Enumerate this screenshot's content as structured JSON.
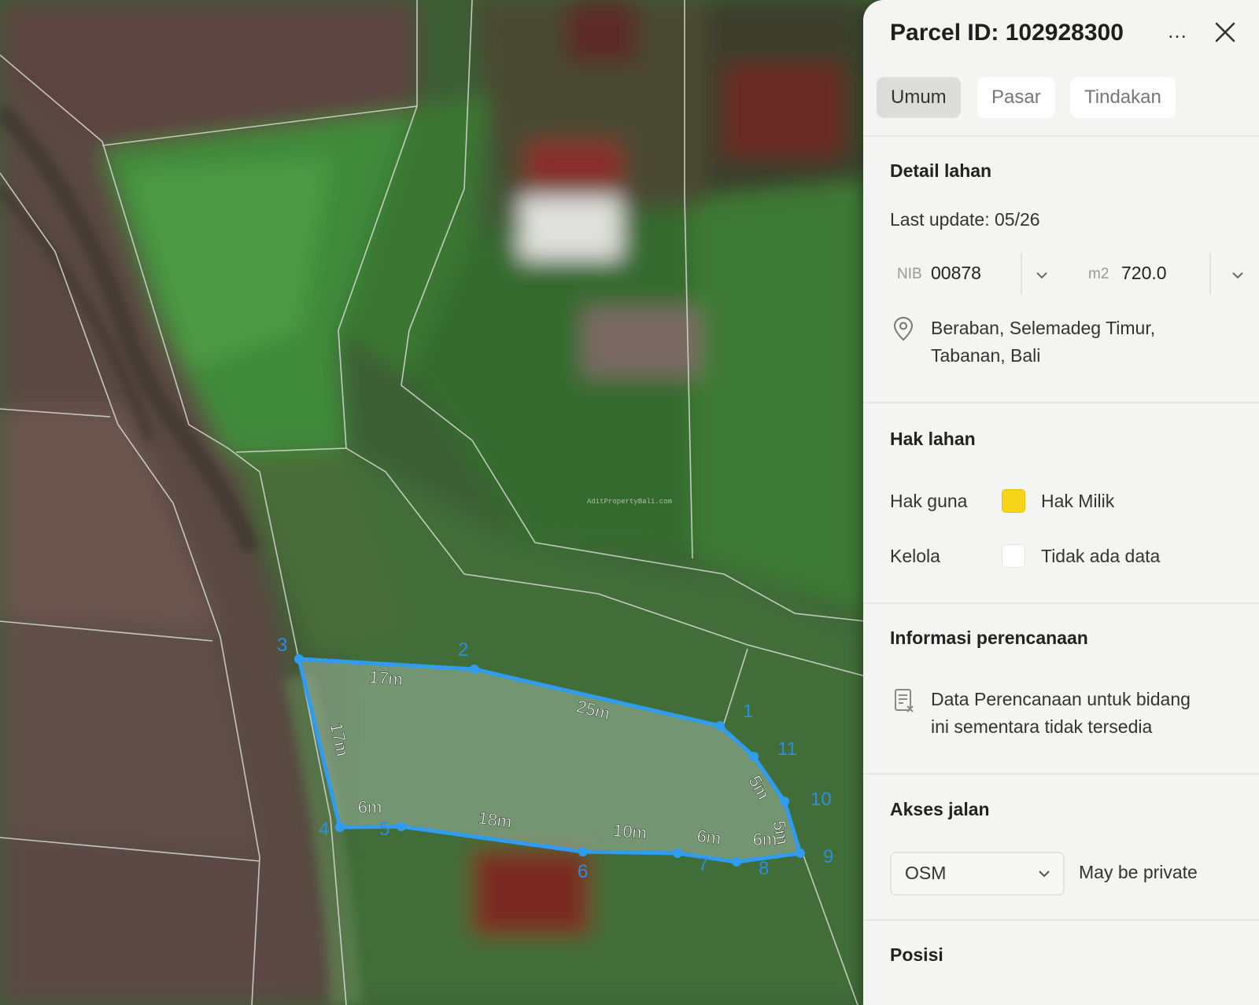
{
  "map": {
    "watermark": "AditPropertyBali.com",
    "vertices": [
      "1",
      "2",
      "3",
      "4",
      "5",
      "6",
      "7",
      "8",
      "9",
      "10",
      "11"
    ],
    "edges": [
      "17m",
      "25m",
      "17m",
      "6m",
      "18m",
      "10m",
      "6m",
      "6m",
      "5m",
      "5m"
    ],
    "colors": {
      "parcel_outline": "#2f9cf0",
      "parcel_fill": "#9fb7a0",
      "boundary": "#d8dcd6"
    }
  },
  "panel": {
    "title": "Parcel ID: 102928300",
    "more_icon": "…",
    "tabs": [
      {
        "label": "Umum",
        "active": true
      },
      {
        "label": "Pasar",
        "active": false
      },
      {
        "label": "Tindakan",
        "active": false
      }
    ],
    "land_details": {
      "heading": "Detail lahan",
      "last_update": "Last update: 05/26",
      "nib_label": "NIB",
      "nib_value": "00878",
      "area_label": "m2",
      "area_value": "720.0",
      "address_line1": "Beraban, Selemadeg Timur,",
      "address_line2": "Tabanan, Bali"
    },
    "land_rights": {
      "heading": "Hak lahan",
      "rows": [
        {
          "label": "Hak guna",
          "color": "#f6d419",
          "value": "Hak Milik"
        },
        {
          "label": "Kelola",
          "color": "#ffffff",
          "value": "Tidak ada data"
        }
      ]
    },
    "planning": {
      "heading": "Informasi perencanaan",
      "message_line1": "Data Perencanaan untuk bidang",
      "message_line2": "ini sementara tidak tersedia"
    },
    "road_access": {
      "heading": "Akses jalan",
      "select_value": "OSM",
      "note": "May be private"
    },
    "position": {
      "heading": "Posisi"
    }
  }
}
